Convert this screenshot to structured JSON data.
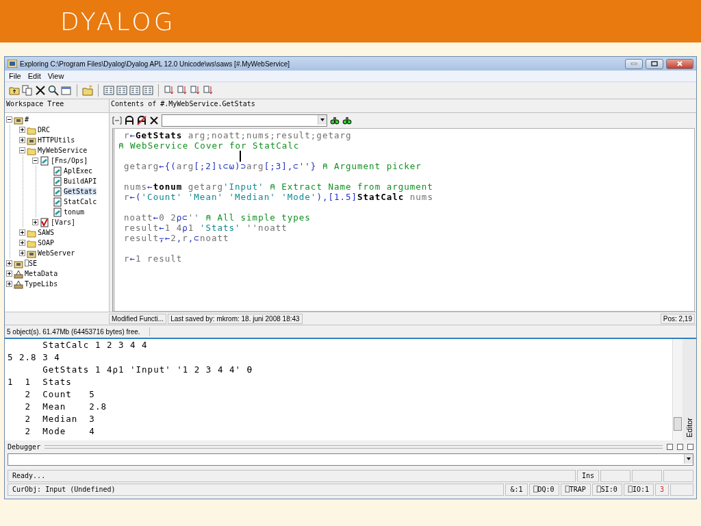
{
  "slide": {
    "logo": "DYALOG"
  },
  "window": {
    "title": "Exploring C:\\Program Files\\Dyalog\\Dyalog APL 12.0 Unicode\\ws\\saws [#.MyWebService]",
    "menu": [
      "File",
      "Edit",
      "View"
    ],
    "toolbar": [
      [
        {
          "kind": "up"
        },
        {
          "kind": "copy"
        },
        {
          "kind": "delete"
        },
        {
          "kind": "search"
        },
        {
          "kind": "properties"
        }
      ],
      [
        {
          "kind": "new"
        }
      ],
      [
        {
          "kind": "view"
        },
        {
          "kind": "view"
        },
        {
          "kind": "view"
        },
        {
          "kind": "view"
        }
      ],
      [
        {
          "kind": "sort"
        },
        {
          "kind": "sort"
        },
        {
          "kind": "sort"
        },
        {
          "kind": "sort"
        }
      ]
    ],
    "tree": {
      "header": "Workspace Tree",
      "items": [
        {
          "label": "#",
          "kind": "namespace",
          "expanded": true,
          "selected": false,
          "children": [
            {
              "label": "DRC",
              "kind": "folder",
              "expanded": false,
              "selected": false
            },
            {
              "label": "HTTPUtils",
              "kind": "namespace",
              "expanded": false,
              "selected": false
            },
            {
              "label": "MyWebService",
              "kind": "folder",
              "expanded": true,
              "selected": false,
              "children": [
                {
                  "label": "[Fns/Ops]",
                  "kind": "function",
                  "expanded": true,
                  "selected": false,
                  "children": [
                    {
                      "label": "AplExec",
                      "kind": "function",
                      "selected": false
                    },
                    {
                      "label": "BuildAPI",
                      "kind": "function",
                      "selected": false
                    },
                    {
                      "label": "GetStats",
                      "kind": "function",
                      "selected": true
                    },
                    {
                      "label": "StatCalc",
                      "kind": "function",
                      "selected": false
                    },
                    {
                      "label": "tonum",
                      "kind": "function",
                      "selected": false
                    }
                  ]
                },
                {
                  "label": "[Vars]",
                  "kind": "vars",
                  "expanded": false,
                  "selected": false
                }
              ]
            },
            {
              "label": "SAWS",
              "kind": "folder",
              "expanded": false,
              "selected": false
            },
            {
              "label": "SOAP",
              "kind": "folder",
              "expanded": false,
              "selected": false
            },
            {
              "label": "WebServer",
              "kind": "namespace",
              "expanded": false,
              "selected": false
            }
          ]
        },
        {
          "label": "⎕SE",
          "kind": "namespace",
          "expanded": false,
          "selected": false
        },
        {
          "label": "MetaData",
          "kind": "tool",
          "expanded": false,
          "selected": false
        },
        {
          "label": "TypeLibs",
          "kind": "tool",
          "expanded": false,
          "selected": false
        }
      ]
    },
    "editor": {
      "header": "Contents of #.MyWebService.GetStats",
      "lines": [
        {
          "kind": "code",
          "segments": [
            {
              "kind": "name",
              "text": "r"
            },
            {
              "kind": "sym",
              "text": "←"
            },
            {
              "kind": "bold",
              "text": "GetStats"
            },
            {
              "kind": "name",
              "text": " arg;noatt;nums;result;getarg"
            }
          ]
        },
        {
          "kind": "comment",
          "segments": [
            {
              "kind": "comment",
              "text": "⍝ WebService Cover for StatCalc"
            }
          ]
        },
        {
          "kind": "blank"
        },
        {
          "kind": "code",
          "segments": [
            {
              "kind": "name",
              "text": "getarg"
            },
            {
              "kind": "sym",
              "text": "←{("
            },
            {
              "kind": "name",
              "text": "arg"
            },
            {
              "kind": "sym",
              "text": "[;2]⍳⊂⍵)⊃"
            },
            {
              "kind": "name",
              "text": "arg"
            },
            {
              "kind": "sym",
              "text": "[;3],⊂''}"
            },
            {
              "kind": "comment",
              "text": " ⍝ Argument picker"
            }
          ]
        },
        {
          "kind": "blank"
        },
        {
          "kind": "code",
          "segments": [
            {
              "kind": "name",
              "text": "nums"
            },
            {
              "kind": "sym",
              "text": "←"
            },
            {
              "kind": "bold",
              "text": "tonum"
            },
            {
              "kind": "name",
              "text": " getarg"
            },
            {
              "kind": "string",
              "text": "'Input'"
            },
            {
              "kind": "comment",
              "text": " ⍝ Extract Name from argument"
            }
          ]
        },
        {
          "kind": "code",
          "segments": [
            {
              "kind": "name",
              "text": "r"
            },
            {
              "kind": "sym",
              "text": "←("
            },
            {
              "kind": "string",
              "text": "'Count' 'Mean' 'Median' 'Mode'"
            },
            {
              "kind": "sym",
              "text": "),[1.5]"
            },
            {
              "kind": "bold",
              "text": "StatCalc"
            },
            {
              "kind": "name",
              "text": " nums"
            }
          ]
        },
        {
          "kind": "blank"
        },
        {
          "kind": "code",
          "segments": [
            {
              "kind": "name",
              "text": "noatt"
            },
            {
              "kind": "sym",
              "text": "←"
            },
            {
              "kind": "name",
              "text": "0 2"
            },
            {
              "kind": "sym",
              "text": "⍴⊂"
            },
            {
              "kind": "name",
              "text": "''"
            },
            {
              "kind": "comment",
              "text": " ⍝ All simple types"
            }
          ]
        },
        {
          "kind": "code",
          "segments": [
            {
              "kind": "name",
              "text": "result"
            },
            {
              "kind": "sym",
              "text": "←"
            },
            {
              "kind": "name",
              "text": "1 4"
            },
            {
              "kind": "sym",
              "text": "⍴"
            },
            {
              "kind": "name",
              "text": "1 "
            },
            {
              "kind": "string",
              "text": "'Stats'"
            },
            {
              "kind": "name",
              "text": " ''noatt"
            }
          ]
        },
        {
          "kind": "code",
          "segments": [
            {
              "kind": "name",
              "text": "result"
            },
            {
              "kind": "sym",
              "text": "⍪←"
            },
            {
              "kind": "name",
              "text": "2"
            },
            {
              "kind": "sym",
              "text": ","
            },
            {
              "kind": "name",
              "text": "r"
            },
            {
              "kind": "sym",
              "text": ",⊂"
            },
            {
              "kind": "name",
              "text": "noatt"
            }
          ]
        },
        {
          "kind": "blank"
        },
        {
          "kind": "code",
          "segments": [
            {
              "kind": "name",
              "text": "r"
            },
            {
              "kind": "sym",
              "text": "←"
            },
            {
              "kind": "name",
              "text": "1 result"
            }
          ]
        }
      ]
    },
    "editor_status": [
      "Modified Functi...",
      "Last saved by: mkrom: 18. juni 2008 18:43",
      "Pos: 2,19"
    ],
    "status": "5 object(s). 61.47Mb (64453716 bytes) free."
  },
  "session": {
    "lines": [
      "      StatCalc 1 2 3 4 4",
      "5 2.8 3 4",
      "      GetStats 1 4⍴1 'Input' '1 2 3 4 4' ⍬",
      "1  1  Stats",
      "   2  Count   5",
      "   2  Mean    2.8",
      "   2  Median  3",
      "   2  Mode    4"
    ],
    "side_tab": "Editor"
  },
  "debugger": {
    "title": "Debugger"
  },
  "status_bar": {
    "message": "Ready...",
    "mode": "Ins",
    "curobj": "CurObj: Input (Undefined)",
    "fields": [
      {
        "text": "&:1",
        "alert": false
      },
      {
        "text": "⎕DQ:0",
        "alert": false
      },
      {
        "text": "⎕TRAP",
        "alert": false
      },
      {
        "text": "⎕SI:0",
        "alert": false
      },
      {
        "text": "⎕IO:1",
        "alert": false
      },
      {
        "text": "3",
        "alert": true
      }
    ]
  }
}
